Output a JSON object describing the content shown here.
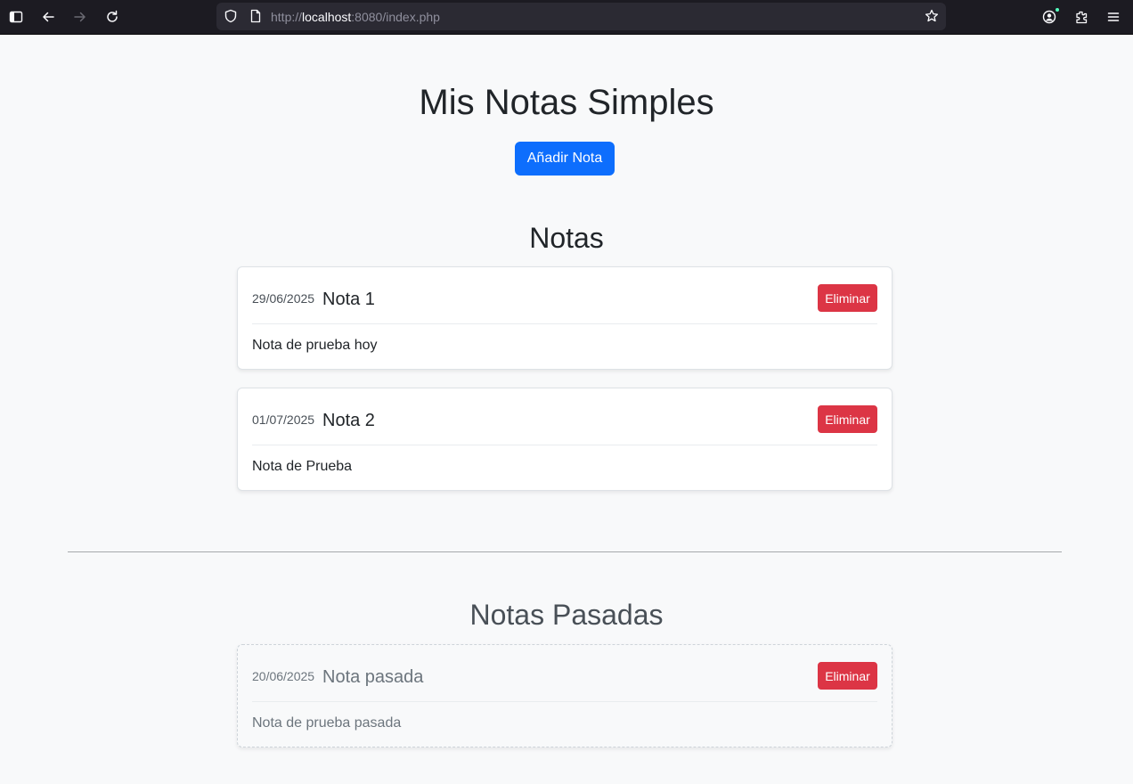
{
  "browser": {
    "url_prefix": "http://",
    "url_host": "localhost",
    "url_suffix": ":8080/index.php"
  },
  "page": {
    "title": "Mis Notas Simples",
    "add_button": "Añadir Nota"
  },
  "notes_section": {
    "title": "Notas",
    "notes": [
      {
        "date": "29/06/2025",
        "title": "Nota 1",
        "text": "Nota de prueba hoy",
        "delete_label": "Eliminar"
      },
      {
        "date": "01/07/2025",
        "title": "Nota 2",
        "text": "Nota de Prueba",
        "delete_label": "Eliminar"
      }
    ]
  },
  "past_section": {
    "title": "Notas Pasadas",
    "notes": [
      {
        "date": "20/06/2025",
        "title": "Nota pasada",
        "text": "Nota de prueba pasada",
        "delete_label": "Eliminar"
      }
    ]
  },
  "colors": {
    "primary": "#0d6efd",
    "danger": "#dc3545",
    "background": "#f8f9fa"
  }
}
